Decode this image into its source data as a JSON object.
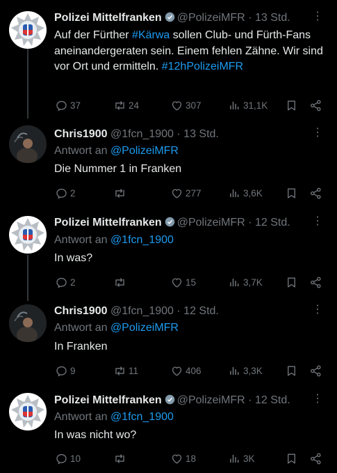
{
  "tweets": [
    {
      "author": "Polizei Mittelfranken",
      "handle": "@PolizeiMFR",
      "time": "13 Std.",
      "reply_prefix": "",
      "reply_mention": "",
      "text_parts": [
        {
          "t": "Auf der Fürther ",
          "tag": false
        },
        {
          "t": "#Kärwa",
          "tag": true
        },
        {
          "t": " sollen Club- und Fürth-Fans aneinandergeraten sein. Einem fehlen Zähne. Wir sind vor Ort und ermitteln. ",
          "tag": false
        },
        {
          "t": "#12hPolizeiMFR",
          "tag": true
        }
      ],
      "replies": "37",
      "retweets": "24",
      "likes": "307",
      "views": "31,1K"
    },
    {
      "author": "Chris1900",
      "handle": "@1fcn_1900",
      "time": "13 Std.",
      "reply_prefix": "Antwort an",
      "reply_mention": "@PolizeiMFR",
      "text_parts": [
        {
          "t": "Die Nummer 1 in Franken",
          "tag": false
        }
      ],
      "replies": "2",
      "retweets": "",
      "likes": "277",
      "views": "3,6K"
    },
    {
      "author": "Polizei Mittelfranken",
      "handle": "@PolizeiMFR",
      "time": "12 Std.",
      "reply_prefix": "Antwort an",
      "reply_mention": "@1fcn_1900",
      "text_parts": [
        {
          "t": "In was?",
          "tag": false
        }
      ],
      "replies": "2",
      "retweets": "",
      "likes": "15",
      "views": "3,7K"
    },
    {
      "author": "Chris1900",
      "handle": "@1fcn_1900",
      "time": "12 Std.",
      "reply_prefix": "Antwort an",
      "reply_mention": "@PolizeiMFR",
      "text_parts": [
        {
          "t": "In Franken",
          "tag": false
        }
      ],
      "replies": "9",
      "retweets": "11",
      "likes": "406",
      "views": "3,3K"
    },
    {
      "author": "Polizei Mittelfranken",
      "handle": "@PolizeiMFR",
      "time": "12 Std.",
      "reply_prefix": "Antwort an",
      "reply_mention": "@1fcn_1900",
      "text_parts": [
        {
          "t": "In was nicht wo?",
          "tag": false
        }
      ],
      "replies": "10",
      "retweets": "",
      "likes": "18",
      "views": "3K"
    }
  ],
  "separator": "·",
  "more_glyph": "⋮",
  "colors": {
    "background": "#000000",
    "text": "#e7e9ea",
    "muted": "#71767b",
    "link": "#1d9bf0",
    "thread": "#333639"
  }
}
